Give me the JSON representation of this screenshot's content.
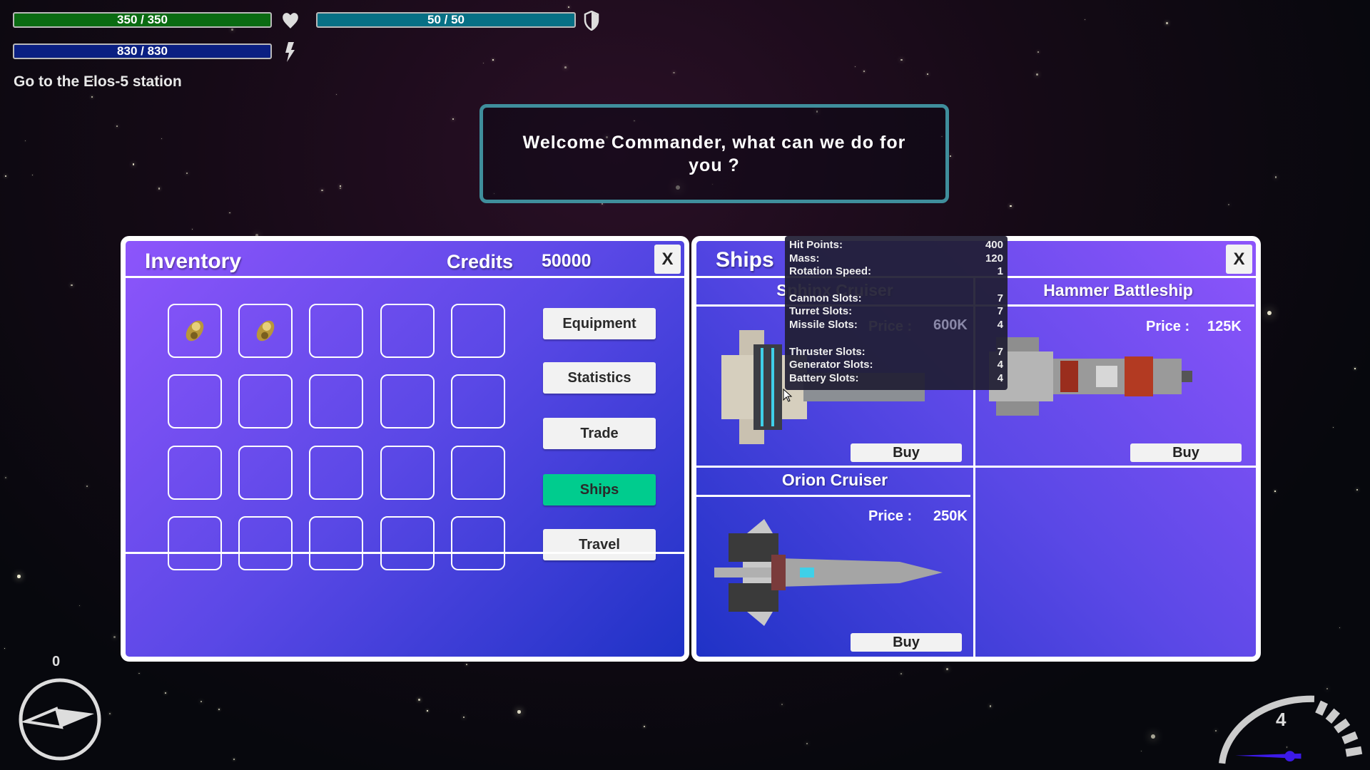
{
  "hud": {
    "health": {
      "text": "350 / 350",
      "value": 350,
      "max": 350,
      "color": "#0a6b12",
      "icon": "heart-icon"
    },
    "shield": {
      "text": "50 / 50",
      "value": 50,
      "max": 50,
      "color": "#077085",
      "icon": "shield-icon"
    },
    "energy": {
      "text": "830 / 830",
      "value": 830,
      "max": 830,
      "color": "#0a1f82",
      "icon": "lightning-icon"
    },
    "mission": "Go to the Elos-5 station",
    "heading": "0",
    "speed": "4"
  },
  "dialog": {
    "text": "Welcome Commander, what can we do for you ?"
  },
  "inventory": {
    "title": "Inventory",
    "credits_label": "Credits",
    "credits": "50000",
    "close": "X",
    "slots_filled": [
      true,
      true,
      false,
      false,
      false,
      false,
      false,
      false,
      false,
      false,
      false,
      false,
      false,
      false,
      false,
      false,
      false,
      false,
      false,
      false
    ],
    "menu": [
      {
        "label": "Equipment"
      },
      {
        "label": "Statistics"
      },
      {
        "label": "Trade"
      },
      {
        "label": "Ships",
        "active": true
      },
      {
        "label": "Travel"
      }
    ],
    "active_color": "#00cc8e"
  },
  "ships": {
    "title": "Ships",
    "close": "X",
    "price_label": "Price :",
    "buy_label": "Buy",
    "items": [
      {
        "name": "Sphinx Cruiser",
        "price": "600K"
      },
      {
        "name": "Hammer Battleship",
        "price": "125K"
      },
      {
        "name": "Orion Cruiser",
        "price": "250K"
      }
    ]
  },
  "tooltip": {
    "rows": [
      {
        "label": "Hit Points:",
        "value": "400"
      },
      {
        "label": "Mass:",
        "value": "120"
      },
      {
        "label": "Rotation Speed:",
        "value": "1"
      },
      {
        "label": "",
        "value": ""
      },
      {
        "label": "Cannon Slots:",
        "value": "7"
      },
      {
        "label": "Turret Slots:",
        "value": "7"
      },
      {
        "label": "Missile Slots:",
        "value": "4"
      },
      {
        "label": "",
        "value": ""
      },
      {
        "label": "Thruster Slots:",
        "value": "7"
      },
      {
        "label": "Generator Slots:",
        "value": "4"
      },
      {
        "label": "Battery Slots:",
        "value": "4"
      }
    ]
  }
}
